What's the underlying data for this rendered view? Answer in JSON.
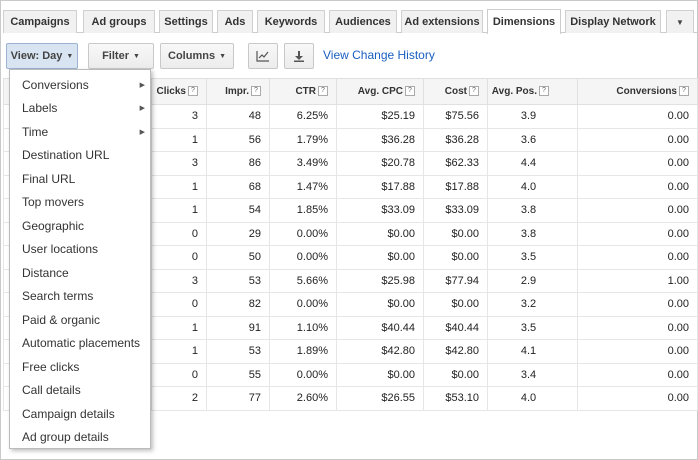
{
  "tabs": [
    "Campaigns",
    "Ad groups",
    "Settings",
    "Ads",
    "Keywords",
    "Audiences",
    "Ad extensions",
    "Dimensions",
    "Display Network"
  ],
  "active_tab": "Dimensions",
  "toolbar": {
    "view_label": "View: Day",
    "filter_label": "Filter",
    "columns_label": "Columns",
    "chart_icon": "line-chart-icon",
    "download_icon": "download-icon",
    "history_link": "View Change History"
  },
  "help_glyph": "?",
  "table": {
    "headers": [
      "Clicks",
      "Impr.",
      "CTR",
      "Avg. CPC",
      "Cost",
      "Avg. Pos.",
      "Conversions"
    ],
    "rows": [
      [
        "3",
        "48",
        "6.25%",
        "$25.19",
        "$75.56",
        "3.9",
        "0.00"
      ],
      [
        "1",
        "56",
        "1.79%",
        "$36.28",
        "$36.28",
        "3.6",
        "0.00"
      ],
      [
        "3",
        "86",
        "3.49%",
        "$20.78",
        "$62.33",
        "4.4",
        "0.00"
      ],
      [
        "1",
        "68",
        "1.47%",
        "$17.88",
        "$17.88",
        "4.0",
        "0.00"
      ],
      [
        "1",
        "54",
        "1.85%",
        "$33.09",
        "$33.09",
        "3.8",
        "0.00"
      ],
      [
        "0",
        "29",
        "0.00%",
        "$0.00",
        "$0.00",
        "3.8",
        "0.00"
      ],
      [
        "0",
        "50",
        "0.00%",
        "$0.00",
        "$0.00",
        "3.5",
        "0.00"
      ],
      [
        "3",
        "53",
        "5.66%",
        "$25.98",
        "$77.94",
        "2.9",
        "1.00"
      ],
      [
        "0",
        "82",
        "0.00%",
        "$0.00",
        "$0.00",
        "3.2",
        "0.00"
      ],
      [
        "1",
        "91",
        "1.10%",
        "$40.44",
        "$40.44",
        "3.5",
        "0.00"
      ],
      [
        "1",
        "53",
        "1.89%",
        "$42.80",
        "$42.80",
        "4.1",
        "0.00"
      ],
      [
        "0",
        "55",
        "0.00%",
        "$0.00",
        "$0.00",
        "3.4",
        "0.00"
      ],
      [
        "2",
        "77",
        "2.60%",
        "$26.55",
        "$53.10",
        "4.0",
        "0.00"
      ]
    ]
  },
  "menu": {
    "items": [
      {
        "label": "Conversions",
        "submenu": true
      },
      {
        "label": "Labels",
        "submenu": true
      },
      {
        "label": "Time",
        "submenu": true
      },
      {
        "label": "Destination URL",
        "submenu": false
      },
      {
        "label": "Final URL",
        "submenu": false
      },
      {
        "label": "Top movers",
        "submenu": false
      },
      {
        "label": "Geographic",
        "submenu": false
      },
      {
        "label": "User locations",
        "submenu": false
      },
      {
        "label": "Distance",
        "submenu": false
      },
      {
        "label": "Search terms",
        "submenu": false
      },
      {
        "label": "Paid & organic",
        "submenu": false
      },
      {
        "label": "Automatic placements",
        "submenu": false
      },
      {
        "label": "Free clicks",
        "submenu": false
      },
      {
        "label": "Call details",
        "submenu": false
      },
      {
        "label": "Campaign details",
        "submenu": false
      },
      {
        "label": "Ad group details",
        "submenu": false
      }
    ]
  },
  "colors": {
    "link": "#1b5fc1",
    "pressed_button": "#d9e4f2"
  }
}
